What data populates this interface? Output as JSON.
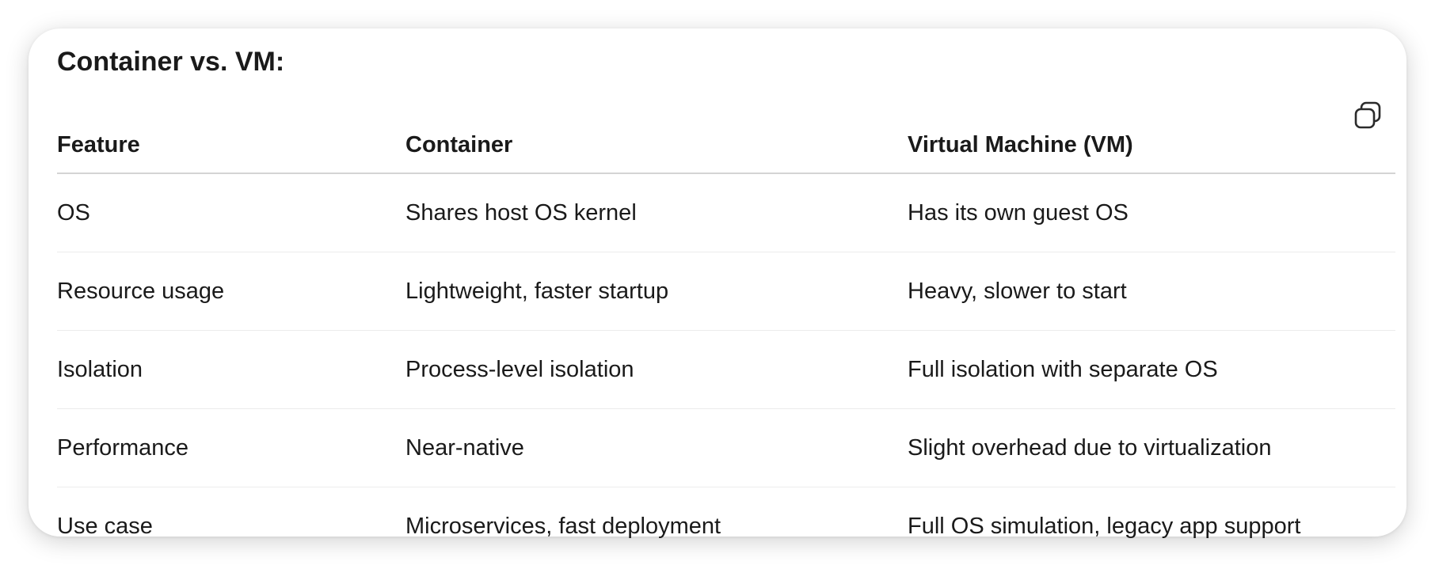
{
  "title": "Container vs. VM:",
  "copy_icon": "copy-icon",
  "table": {
    "headers": [
      "Feature",
      "Container",
      "Virtual Machine (VM)"
    ],
    "rows": [
      [
        "OS",
        "Shares host OS kernel",
        "Has its own guest OS"
      ],
      [
        "Resource usage",
        "Lightweight, faster startup",
        "Heavy, slower to start"
      ],
      [
        "Isolation",
        "Process-level isolation",
        "Full isolation with separate OS"
      ],
      [
        "Performance",
        "Near-native",
        "Slight overhead due to virtualization"
      ],
      [
        "Use case",
        "Microservices, fast deployment",
        "Full OS simulation, legacy app support"
      ]
    ]
  },
  "colors": {
    "text": "#1a1a1a",
    "header_rule": "#d4d4d4",
    "row_rule": "#ececec",
    "card_bg": "#ffffff"
  }
}
